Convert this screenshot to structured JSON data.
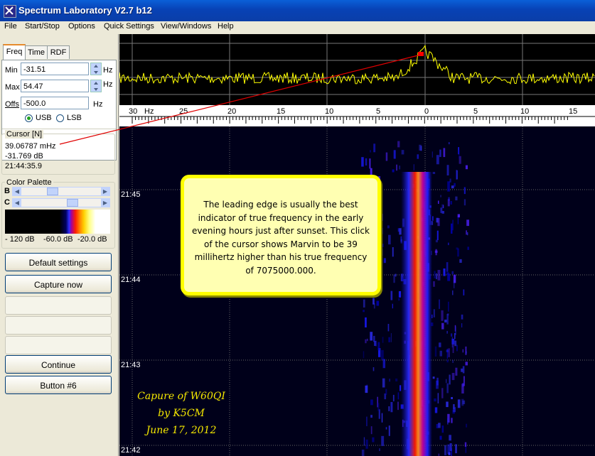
{
  "window": {
    "title": "Spectrum Laboratory V2.7 b12"
  },
  "menu": [
    "File",
    "Start/Stop",
    "Options",
    "Quick Settings",
    "View/Windows",
    "Help"
  ],
  "tabs": [
    "Freq",
    "Time",
    "RDF"
  ],
  "freq": {
    "min_label": "Min",
    "min_value": "-31.51",
    "min_unit": "Hz",
    "max_label": "Max",
    "max_value": "54.47",
    "max_unit": "Hz",
    "offs_label": "Offs",
    "offs_value": "-500.0",
    "offs_unit": "Hz",
    "usb_label": "USB",
    "lsb_label": "LSB",
    "selected": "USB"
  },
  "cursor": {
    "label": "Cursor [N]",
    "line1": "39.06787 mHz",
    "line2": "-31.769 dB",
    "line3": "21:44:35.9"
  },
  "palette": {
    "label": "Color Palette",
    "b_label": "B",
    "c_label": "C",
    "db1": "- 120 dB",
    "db2": "-60.0 dB",
    "db3": "-20.0 dB"
  },
  "buttons": [
    "Default settings",
    "Capture now",
    "",
    "",
    "",
    "Continue",
    "Button #6"
  ],
  "scale": {
    "unit": "Hz",
    "ticks": [
      "30",
      "25",
      "20",
      "15",
      "10",
      "5",
      "0",
      "5",
      "10",
      "15"
    ]
  },
  "waterfall": {
    "times": [
      "21:45",
      "21:44",
      "21:43",
      "21:42"
    ]
  },
  "annotation": {
    "text": "The leading edge is usually the best indicator of true frequency in the early evening hours just after sunset. This click of the cursor shows Marvin to be 39 millihertz higher than his true frequency of 7075000.000.",
    "caption1": "Capure of W60QI",
    "caption2": "by K5CM",
    "caption3": "June 17, 2012"
  },
  "colors": {
    "trace": "#ffff00",
    "marker": "#ff0000",
    "callout_border": "#ffff00",
    "caption": "#f5e800"
  }
}
